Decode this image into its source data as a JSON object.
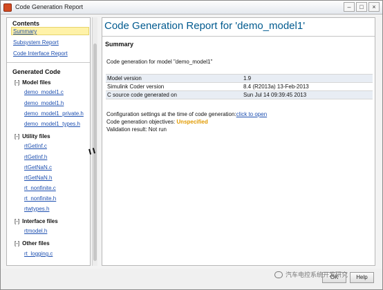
{
  "window": {
    "title": "Code Generation Report",
    "minimize": "–",
    "maximize": "□",
    "close": "×"
  },
  "sidebar": {
    "contents_title": "Contents",
    "links": [
      {
        "label": "Summary"
      },
      {
        "label": "Subsystem Report"
      },
      {
        "label": "Code Interface Report"
      }
    ],
    "generated_title": "Generated Code",
    "groups": [
      {
        "toggle": "[-]",
        "title": "Model files",
        "files": [
          "demo_model1.c",
          "demo_model1.h",
          "demo_model1_private.h",
          "demo_model1_types.h"
        ]
      },
      {
        "toggle": "[-]",
        "title": "Utility files",
        "files": [
          "rtGetInf.c",
          "rtGetInf.h",
          "rtGetNaN.c",
          "rtGetNaN.h",
          "rt_nonfinite.c",
          "rt_nonfinite.h",
          "rtwtypes.h"
        ]
      },
      {
        "toggle": "[-]",
        "title": "Interface files",
        "files": [
          "rtmodel.h"
        ]
      },
      {
        "toggle": "[-]",
        "title": "Other files",
        "files": [
          "rt_logging.c"
        ]
      }
    ]
  },
  "main": {
    "title": "Code Generation Report for 'demo_model1'",
    "summary_title": "Summary",
    "intro": "Code generation for model \"demo_model1\"",
    "info_rows": [
      {
        "key": "Model version",
        "value": "1.9"
      },
      {
        "key": "Simulink Coder version",
        "value": "8.4 (R2013a) 13-Feb-2013"
      },
      {
        "key": "C source code generated on",
        "value": "Sun Jul 14 09:39:45 2013"
      }
    ],
    "config_prefix": "Configuration settings at the time of code generation:",
    "config_link": "click to open",
    "objectives_prefix": "Code generation objectives: ",
    "objectives_value": "Unspecified",
    "validation": "Validation result: Not run"
  },
  "footer": {
    "ok": "OK",
    "help": "Help"
  },
  "watermark": {
    "text": "汽车电控系统开发研究"
  },
  "colors": {
    "title": "#005a8f",
    "link": "#1d4fb0",
    "highlight": "#fff2a8",
    "unspecified": "#e19a00"
  }
}
